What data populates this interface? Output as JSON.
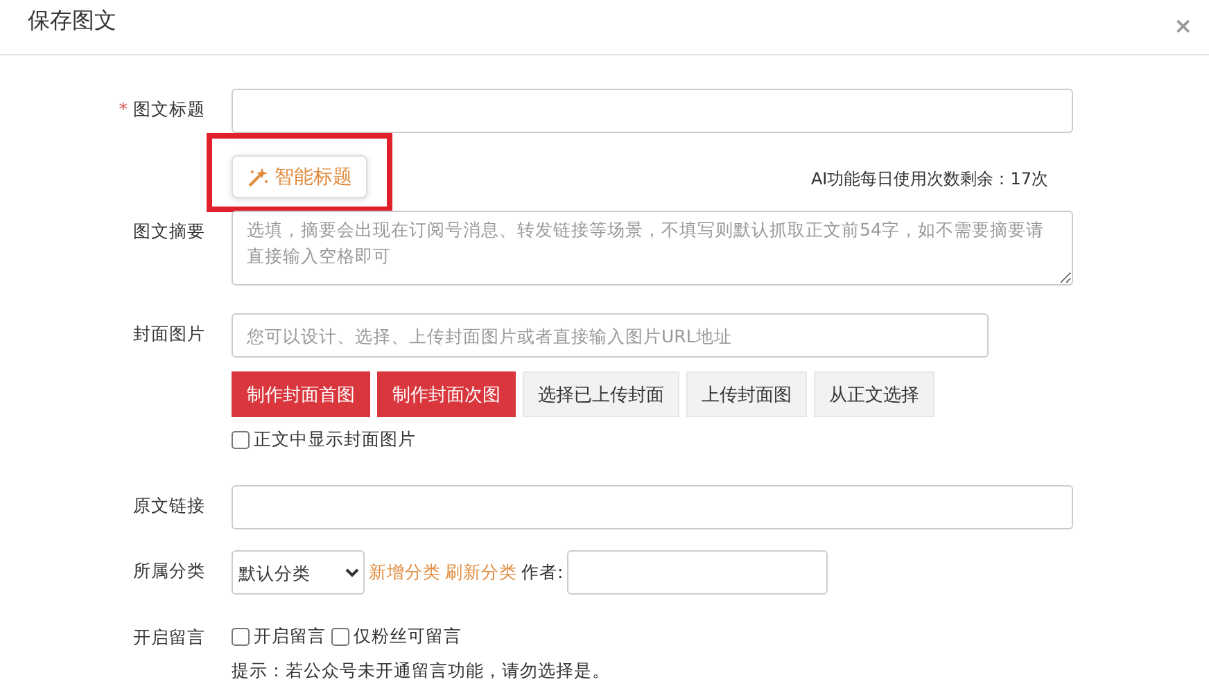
{
  "dialog": {
    "title": "保存图文",
    "close": "×"
  },
  "title_field": {
    "label": "图文标题",
    "required_mark": "*"
  },
  "smart_title_button": {
    "label": "智能标题",
    "highlighted": true
  },
  "ai_quota": "AI功能每日使用次数剩余：17次",
  "summary_field": {
    "label": "图文摘要",
    "placeholder": "选填，摘要会出现在订阅号消息、转发链接等场景，不填写则默认抓取正文前54字，如不需要摘要请直接输入空格即可"
  },
  "cover_field": {
    "label": "封面图片",
    "placeholder": "您可以设计、选择、上传封面图片或者直接输入图片URL地址"
  },
  "cover_buttons": [
    {
      "label": "制作封面首图",
      "kind": "primary"
    },
    {
      "label": "制作封面次图",
      "kind": "primary"
    },
    {
      "label": "选择已上传封面",
      "kind": "default"
    },
    {
      "label": "上传封面图",
      "kind": "default"
    },
    {
      "label": "从正文选择",
      "kind": "default"
    }
  ],
  "show_cover_checkbox": {
    "label": "正文中显示封面图片",
    "checked": false
  },
  "link_field": {
    "label": "原文链接"
  },
  "category": {
    "label": "所属分类",
    "select_value": "默认分类",
    "links": [
      "新增分类",
      "刷新分类"
    ],
    "author_label": "作者:"
  },
  "comments": {
    "label": "开启留言",
    "options": [
      {
        "label": "开启留言",
        "checked": false
      },
      {
        "label": "仅粉丝可留言",
        "checked": false
      }
    ],
    "hint": "提示：若公众号未开通留言功能，请勿选择是。"
  }
}
